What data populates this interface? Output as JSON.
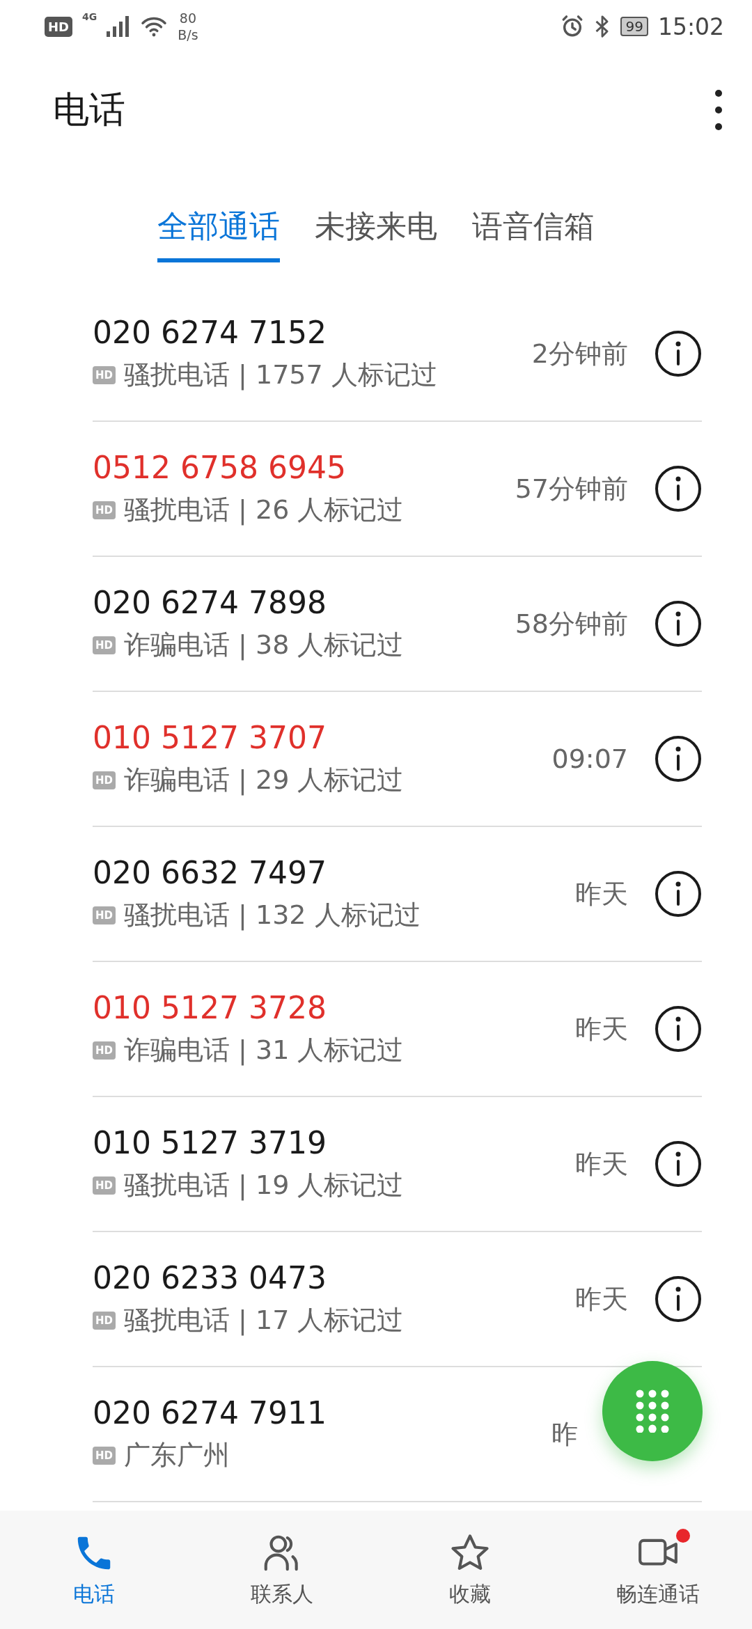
{
  "status_bar": {
    "hd": "HD",
    "network": "4G",
    "speed_value": "80",
    "speed_unit": "B/s",
    "battery": "99",
    "time": "15:02"
  },
  "header": {
    "title": "电话"
  },
  "tabs": [
    {
      "label": "全部通话",
      "selected": true
    },
    {
      "label": "未接来电",
      "selected": false
    },
    {
      "label": "语音信箱",
      "selected": false
    }
  ],
  "calls": [
    {
      "number": "020 6274 7152",
      "missed": false,
      "hd": "HD",
      "detail": "骚扰电话 | 1757 人标记过",
      "time": "2分钟前",
      "info": true
    },
    {
      "number": "0512 6758 6945",
      "missed": true,
      "hd": "HD",
      "detail": "骚扰电话 | 26 人标记过",
      "time": "57分钟前",
      "info": true
    },
    {
      "number": "020 6274 7898",
      "missed": false,
      "hd": "HD",
      "detail": "诈骗电话 | 38 人标记过",
      "time": "58分钟前",
      "info": true
    },
    {
      "number": "010 5127 3707",
      "missed": true,
      "hd": "HD",
      "detail": "诈骗电话 | 29 人标记过",
      "time": "09:07",
      "info": true
    },
    {
      "number": "020 6632 7497",
      "missed": false,
      "hd": "HD",
      "detail": "骚扰电话 | 132 人标记过",
      "time": "昨天",
      "info": true
    },
    {
      "number": "010 5127 3728",
      "missed": true,
      "hd": "HD",
      "detail": "诈骗电话 | 31 人标记过",
      "time": "昨天",
      "info": true
    },
    {
      "number": "010 5127 3719",
      "missed": false,
      "hd": "HD",
      "detail": "骚扰电话 | 19 人标记过",
      "time": "昨天",
      "info": true
    },
    {
      "number": "020 6233 0473",
      "missed": false,
      "hd": "HD",
      "detail": "骚扰电话 | 17 人标记过",
      "time": "昨天",
      "info": true
    },
    {
      "number": "020 6274 7911",
      "missed": false,
      "hd": "HD",
      "detail": "广东广州",
      "time": "昨",
      "info": false
    }
  ],
  "bottom_nav": [
    {
      "label": "电话",
      "kind": "phone",
      "selected": true,
      "badge": false
    },
    {
      "label": "联系人",
      "kind": "contacts",
      "selected": false,
      "badge": false
    },
    {
      "label": "收藏",
      "kind": "star",
      "selected": false,
      "badge": false
    },
    {
      "label": "畅连通话",
      "kind": "video",
      "selected": false,
      "badge": true
    }
  ]
}
